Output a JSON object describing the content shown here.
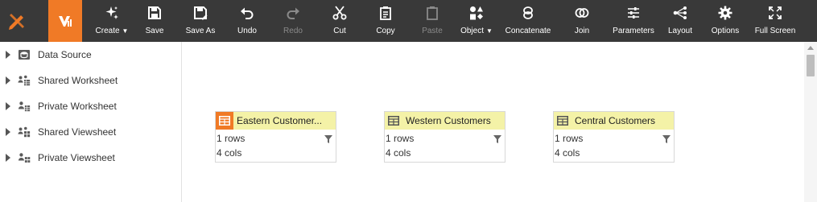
{
  "toolbar": {
    "buttons": [
      {
        "label": "Create",
        "icon": "sparkle-icon",
        "dropdown": true,
        "enabled": true
      },
      {
        "label": "Save",
        "icon": "save-icon",
        "enabled": true
      },
      {
        "label": "Save As",
        "icon": "save-as-icon",
        "enabled": true
      },
      {
        "label": "Undo",
        "icon": "undo-icon",
        "enabled": true
      },
      {
        "label": "Redo",
        "icon": "redo-icon",
        "enabled": false
      },
      {
        "label": "Cut",
        "icon": "scissors-icon",
        "enabled": true
      },
      {
        "label": "Copy",
        "icon": "copy-icon",
        "enabled": true
      },
      {
        "label": "Paste",
        "icon": "clipboard-icon",
        "enabled": false
      },
      {
        "label": "Object",
        "icon": "shapes-icon",
        "dropdown": true,
        "enabled": true
      },
      {
        "label": "Concatenate",
        "icon": "concatenate-icon",
        "enabled": true
      },
      {
        "label": "Join",
        "icon": "join-icon",
        "enabled": true
      },
      {
        "label": "Parameters",
        "icon": "sliders-icon",
        "enabled": true
      },
      {
        "label": "Layout",
        "icon": "layout-tree-icon",
        "enabled": true
      },
      {
        "label": "Options",
        "icon": "gear-icon",
        "enabled": true
      },
      {
        "label": "Full Screen",
        "icon": "fullscreen-icon",
        "enabled": true
      }
    ]
  },
  "sidebar": {
    "items": [
      {
        "label": "Data Source",
        "icon": "database-icon"
      },
      {
        "label": "Shared Worksheet",
        "icon": "shared-worksheet-icon"
      },
      {
        "label": "Private Worksheet",
        "icon": "private-worksheet-icon"
      },
      {
        "label": "Shared Viewsheet",
        "icon": "shared-viewsheet-icon"
      },
      {
        "label": "Private Viewsheet",
        "icon": "private-viewsheet-icon"
      }
    ]
  },
  "canvas": {
    "tables": [
      {
        "title": "Eastern Customer...",
        "rows": "1 rows",
        "cols": "4 cols",
        "primary": true
      },
      {
        "title": "Western Customers",
        "rows": "1 rows",
        "cols": "4 cols",
        "primary": false
      },
      {
        "title": "Central Customers",
        "rows": "1 rows",
        "cols": "4 cols",
        "primary": false
      }
    ]
  },
  "colors": {
    "toolbar_bg": "#393939",
    "brand_orange": "#f07a26",
    "table_header": "#f4f2a7",
    "disabled_text": "#8a8a8a"
  }
}
